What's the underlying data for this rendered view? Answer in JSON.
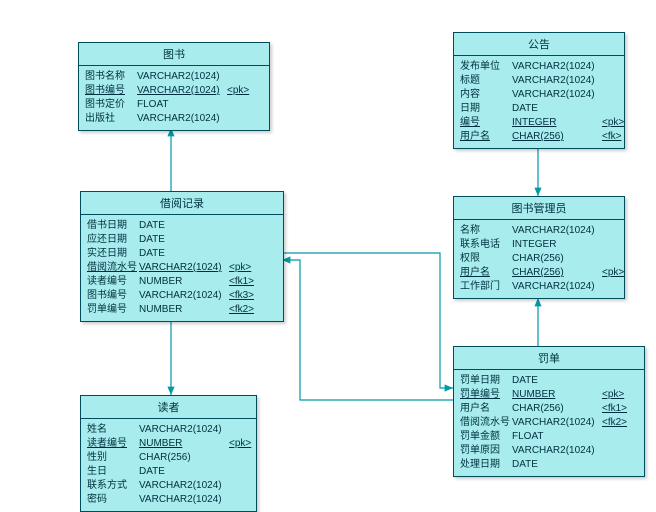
{
  "entities": {
    "book": {
      "title": "图书",
      "rows": [
        {
          "name": "图书名称",
          "type": "VARCHAR2(1024)",
          "tag": "",
          "u": false
        },
        {
          "name": "图书编号",
          "type": "VARCHAR2(1024)",
          "tag": "<pk>",
          "u": true
        },
        {
          "name": "图书定价",
          "type": "FLOAT",
          "tag": "",
          "u": false
        },
        {
          "name": "出版社",
          "type": "VARCHAR2(1024)",
          "tag": "",
          "u": false
        }
      ]
    },
    "notice": {
      "title": "公告",
      "rows": [
        {
          "name": "发布单位",
          "type": "VARCHAR2(1024)",
          "tag": "",
          "u": false
        },
        {
          "name": "标题",
          "type": "VARCHAR2(1024)",
          "tag": "",
          "u": false
        },
        {
          "name": "内容",
          "type": "VARCHAR2(1024)",
          "tag": "",
          "u": false
        },
        {
          "name": "日期",
          "type": "DATE",
          "tag": "",
          "u": false
        },
        {
          "name": "编号",
          "type": "INTEGER",
          "tag": "<pk>",
          "u": true
        },
        {
          "name": "用户名",
          "type": "CHAR(256)",
          "tag": "<fk>",
          "u": true
        }
      ]
    },
    "borrow": {
      "title": "借阅记录",
      "rows": [
        {
          "name": "借书日期",
          "type": "DATE",
          "tag": "",
          "u": false
        },
        {
          "name": "应还日期",
          "type": "DATE",
          "tag": "",
          "u": false
        },
        {
          "name": "实还日期",
          "type": "DATE",
          "tag": "",
          "u": false
        },
        {
          "name": "借阅流水号",
          "type": "VARCHAR2(1024)",
          "tag": "<pk>",
          "u": true
        },
        {
          "name": "读者编号",
          "type": "NUMBER",
          "tag": "<fk1>",
          "u": false
        },
        {
          "name": "图书编号",
          "type": "VARCHAR2(1024)",
          "tag": "<fk3>",
          "u": false
        },
        {
          "name": "罚单编号",
          "type": "NUMBER",
          "tag": "<fk2>",
          "u": false
        }
      ]
    },
    "admin": {
      "title": "图书管理员",
      "rows": [
        {
          "name": "名称",
          "type": "VARCHAR2(1024)",
          "tag": "",
          "u": false
        },
        {
          "name": "联系电话",
          "type": "INTEGER",
          "tag": "",
          "u": false
        },
        {
          "name": "权限",
          "type": "CHAR(256)",
          "tag": "",
          "u": false
        },
        {
          "name": "用户名",
          "type": "CHAR(256)",
          "tag": "<pk>",
          "u": true
        },
        {
          "name": "工作部门",
          "type": "VARCHAR2(1024)",
          "tag": "",
          "u": false
        }
      ]
    },
    "reader": {
      "title": "读者",
      "rows": [
        {
          "name": "姓名",
          "type": "VARCHAR2(1024)",
          "tag": "",
          "u": false
        },
        {
          "name": "读者编号",
          "type": "NUMBER",
          "tag": "<pk>",
          "u": true
        },
        {
          "name": "性别",
          "type": "CHAR(256)",
          "tag": "",
          "u": false
        },
        {
          "name": "生日",
          "type": "DATE",
          "tag": "",
          "u": false
        },
        {
          "name": "联系方式",
          "type": "VARCHAR2(1024)",
          "tag": "",
          "u": false
        },
        {
          "name": "密码",
          "type": "VARCHAR2(1024)",
          "tag": "",
          "u": false
        }
      ]
    },
    "penalty": {
      "title": "罚单",
      "rows": [
        {
          "name": "罚单日期",
          "type": "DATE",
          "tag": "",
          "u": false
        },
        {
          "name": "罚单编号",
          "type": "NUMBER",
          "tag": "<pk>",
          "u": true
        },
        {
          "name": "用户名",
          "type": "CHAR(256)",
          "tag": "<fk1>",
          "u": false
        },
        {
          "name": "借阅流水号",
          "type": "VARCHAR2(1024)",
          "tag": "<fk2>",
          "u": false
        },
        {
          "name": "罚单金额",
          "type": "FLOAT",
          "tag": "",
          "u": false
        },
        {
          "name": "罚单原因",
          "type": "VARCHAR2(1024)",
          "tag": "",
          "u": false
        },
        {
          "name": "处理日期",
          "type": "DATE",
          "tag": "",
          "u": false
        }
      ]
    }
  },
  "chart_data": {
    "type": "diagram",
    "title": "ER Diagram",
    "entities": [
      "图书",
      "公告",
      "借阅记录",
      "图书管理员",
      "读者",
      "罚单"
    ],
    "relationships": [
      {
        "from": "借阅记录",
        "to": "图书",
        "via": "图书编号"
      },
      {
        "from": "借阅记录",
        "to": "读者",
        "via": "读者编号"
      },
      {
        "from": "借阅记录",
        "to": "罚单",
        "via": "罚单编号"
      },
      {
        "from": "罚单",
        "to": "图书管理员",
        "via": "用户名"
      },
      {
        "from": "罚单",
        "to": "借阅记录",
        "via": "借阅流水号"
      },
      {
        "from": "公告",
        "to": "图书管理员",
        "via": "用户名"
      }
    ]
  }
}
